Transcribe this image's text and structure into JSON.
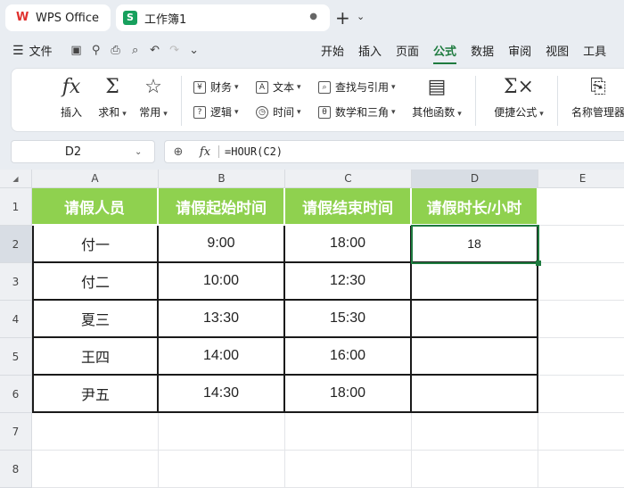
{
  "titlebar": {
    "app_tab": "WPS Office",
    "doc_tab": "工作簿1",
    "doc_tab_modified": "●",
    "new_tab": "+",
    "new_tab_caret": "⌄"
  },
  "menubar": {
    "file": "文件",
    "tabs": [
      "开始",
      "插入",
      "页面",
      "公式",
      "数据",
      "审阅",
      "视图",
      "工具"
    ],
    "active_tab": "公式"
  },
  "ribbon": {
    "insert_fn": "插入",
    "sum": "求和",
    "common": "常用",
    "finance": "财务",
    "logic": "逻辑",
    "text": "文本",
    "time": "时间",
    "lookup": "查找与引用",
    "math": "数学和三角",
    "other_fn": "其他函数",
    "quick_formula": "便捷公式",
    "name_manager": "名称管理器"
  },
  "formula_bar": {
    "cell_ref": "D2",
    "formula": "=HOUR(C2)"
  },
  "grid": {
    "columns": [
      "A",
      "B",
      "C",
      "D",
      "E"
    ],
    "rows": [
      "1",
      "2",
      "3",
      "4",
      "5",
      "6",
      "7",
      "8"
    ],
    "selected_column": "D",
    "selected_row": "2",
    "headers": [
      "请假人员",
      "请假起始时间",
      "请假结束时间",
      "请假时长/小时"
    ],
    "data": [
      [
        "付一",
        "9:00",
        "18:00",
        "18"
      ],
      [
        "付二",
        "10:00",
        "12:30",
        ""
      ],
      [
        "夏三",
        "13:30",
        "15:30",
        ""
      ],
      [
        "王四",
        "14:00",
        "16:00",
        ""
      ],
      [
        "尹五",
        "14:30",
        "18:00",
        ""
      ]
    ]
  },
  "colors": {
    "header_fill": "#8fd14f",
    "accent": "#1e7b3f",
    "brand_red": "#e0312e"
  }
}
